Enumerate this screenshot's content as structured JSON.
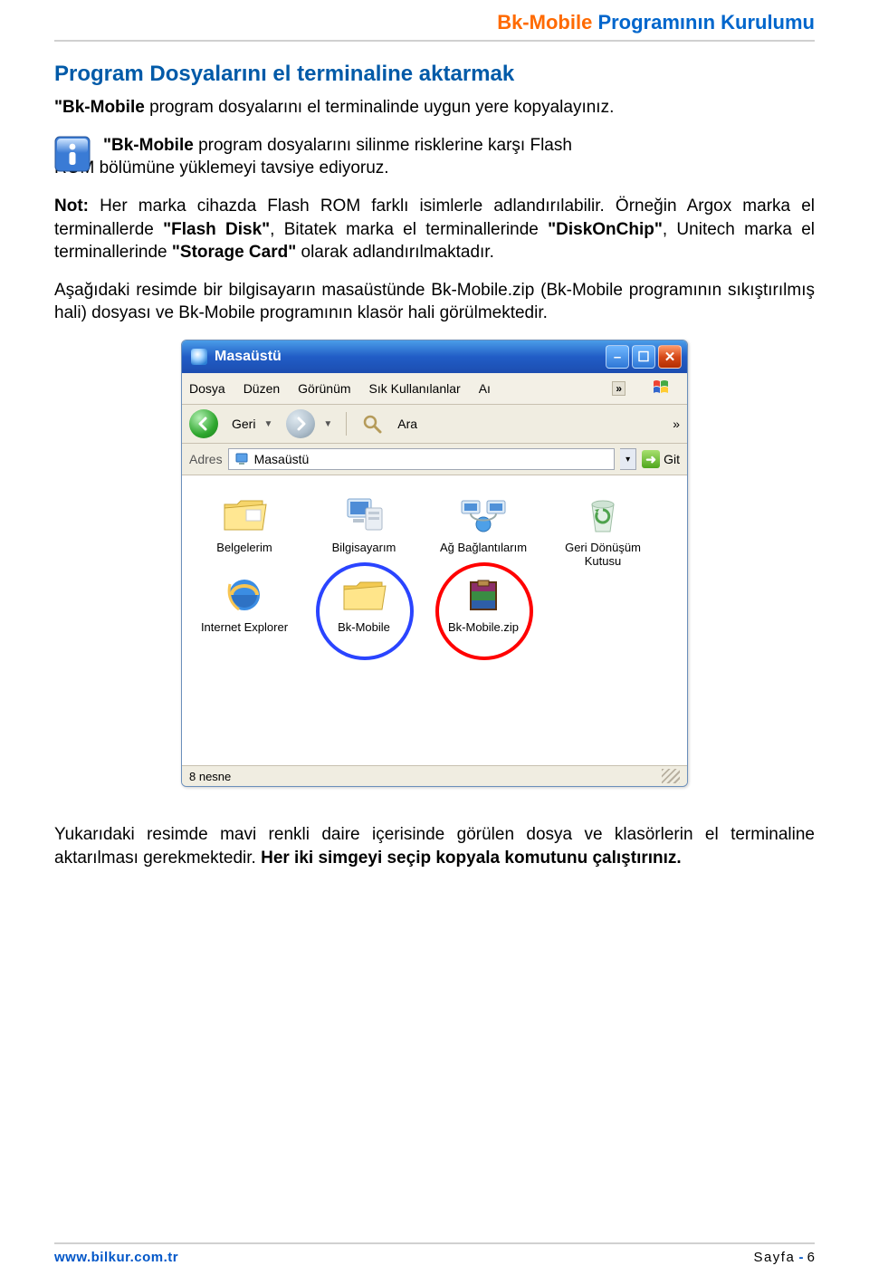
{
  "header": {
    "title_orange": "Bk-Mobile",
    "title_blue": "Programının Kurulumu"
  },
  "section_heading": "Program Dosyalarını el terminaline aktarmak",
  "para1_prefix_bold": "\"Bk-Mobile",
  "para1_rest": " program dosyalarını el terminalinde uygun yere kopyalayınız.",
  "info_line1_prefix_bold": "\"Bk-Mobile",
  "info_line1_rest": " program dosyalarını silinme risklerine karşı Flash",
  "info_line2": "ROM bölümüne yüklemeyi tavsiye ediyoruz.",
  "note_prefix": "Not:",
  "note_body_a": " Her marka cihazda Flash ROM farklı isimlerle adlandırılabilir. Örneğin Argox marka el terminallerde ",
  "note_bold1": "\"Flash Disk\"",
  "note_body_b": ", Bitatek marka el terminallerinde ",
  "note_bold2": "\"DiskOnChip\"",
  "note_body_c": ", Unitech marka el terminallerinde ",
  "note_bold3": "\"Storage Card\"",
  "note_body_d": " olarak adlandırılmaktadır.",
  "para2": "Aşağıdaki resimde bir bilgisayarın masaüstünde Bk-Mobile.zip (Bk-Mobile programının sıkıştırılmış hali) dosyası ve Bk-Mobile programının klasör hali görülmektedir.",
  "explorer": {
    "title": "Masaüstü",
    "menu": {
      "file": "Dosya",
      "edit": "Düzen",
      "view": "Görünüm",
      "fav": "Sık Kullanılanlar",
      "tools": "Aı",
      "more": "»"
    },
    "toolbar": {
      "back": "Geri",
      "search": "Ara",
      "more": "»"
    },
    "address": {
      "label": "Adres",
      "value": "Masaüstü",
      "go": "Git"
    },
    "icons": [
      "Belgelerim",
      "Bilgisayarım",
      "Ağ Bağlantılarım",
      "Geri Dönüşüm Kutusu",
      "Internet Explorer",
      "Bk-Mobile",
      "Bk-Mobile.zip"
    ],
    "status": "8 nesne"
  },
  "para3_a": "Yukarıdaki resimde mavi renkli daire içerisinde görülen dosya ve klasörlerin el terminaline aktarılması gerekmektedir. ",
  "para3_bold": "Her iki simgeyi seçip kopyala komutunu çalıştırınız.",
  "footer": {
    "url": "www.bilkur.com.tr",
    "label": "Sayfa",
    "dash": "-",
    "pagenum": "6"
  }
}
